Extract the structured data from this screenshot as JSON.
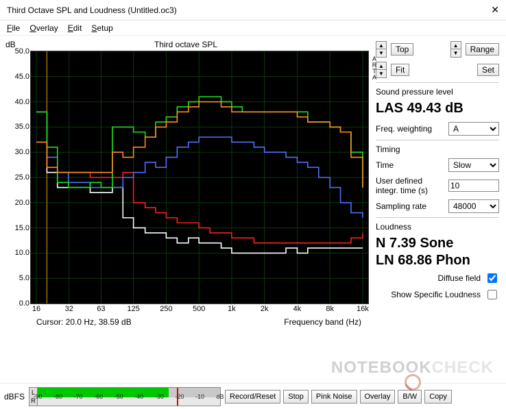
{
  "window": {
    "title": "Third Octave SPL and Loudness (Untitled.oc3)",
    "close": "✕"
  },
  "menu": {
    "file": "File",
    "overlay": "Overlay",
    "edit": "Edit",
    "setup": "Setup"
  },
  "chart": {
    "ylabel": "dB",
    "title": "Third octave SPL",
    "xlabel": "Frequency band (Hz)",
    "cursor": "Cursor:   20.0 Hz, 38.59 dB",
    "brand": "ARTA"
  },
  "controls": {
    "top": "Top",
    "fit": "Fit",
    "range": "Range",
    "set": "Set"
  },
  "spl": {
    "section": "Sound pressure level",
    "value": "LAS 49.43 dB",
    "weight_label": "Freq. weighting",
    "weight_value": "A"
  },
  "timing": {
    "section": "Timing",
    "time_label": "Time",
    "time_value": "Slow",
    "integ_label": "User defined\nintegr. time (s)",
    "integ_value": "10",
    "rate_label": "Sampling rate",
    "rate_value": "48000"
  },
  "loudness": {
    "section": "Loudness",
    "sone": "N 7.39 Sone",
    "phon": "LN 68.86 Phon",
    "diffuse": "Diffuse field",
    "specific": "Show Specific Loudness"
  },
  "bottom": {
    "dbfs": "dBFS",
    "L": "L",
    "R": "R",
    "ticks": [
      "-90",
      "-80",
      "-70",
      "-60",
      "-50",
      "-40",
      "-30",
      "-20",
      "-10",
      "dB"
    ],
    "record": "Record/Reset",
    "stop": "Stop",
    "pink": "Pink Noise",
    "overlay": "Overlay",
    "bw": "B/W",
    "copy": "Copy"
  },
  "watermark": {
    "a": "NOTEBO",
    "b": "OK",
    "c": "CHECK"
  },
  "chart_data": {
    "type": "line",
    "xlabel": "Frequency band (Hz)",
    "ylabel": "dB",
    "ylim": [
      0,
      50
    ],
    "xticks": [
      16,
      32,
      63,
      125,
      250,
      500,
      1000,
      2000,
      4000,
      8000,
      16000
    ],
    "xtick_labels": [
      "16",
      "32",
      "63",
      "125",
      "250",
      "500",
      "1k",
      "2k",
      "4k",
      "8k",
      "16k"
    ],
    "yticks": [
      0,
      5,
      10,
      15,
      20,
      25,
      30,
      35,
      40,
      45,
      50
    ],
    "freq_hz": [
      16,
      20,
      25,
      31.5,
      40,
      50,
      63,
      80,
      100,
      125,
      160,
      200,
      250,
      315,
      400,
      500,
      630,
      800,
      1000,
      1250,
      1600,
      2000,
      2500,
      3150,
      4000,
      5000,
      6300,
      8000,
      10000,
      12500,
      16000
    ],
    "series": [
      {
        "name": "white",
        "color": "#ffffff",
        "values": [
          38,
          26,
          23,
          23,
          23,
          22,
          22,
          23,
          17,
          15,
          14,
          14,
          13,
          12,
          13,
          12,
          12,
          11,
          10,
          10,
          10,
          10,
          10,
          11,
          10,
          11,
          11,
          11,
          11,
          11,
          11
        ]
      },
      {
        "name": "red",
        "color": "#ff2020",
        "values": [
          38,
          27,
          26,
          26,
          26,
          25,
          25,
          25,
          26,
          20,
          19,
          18,
          17,
          16,
          16,
          15,
          14,
          14,
          13,
          13,
          12,
          12,
          12,
          12,
          12,
          12,
          12,
          12,
          12,
          13,
          14
        ]
      },
      {
        "name": "blue",
        "color": "#5070ff",
        "values": [
          38,
          29,
          26,
          24,
          24,
          23,
          23,
          23,
          25,
          26,
          28,
          27,
          29,
          31,
          32,
          33,
          33,
          33,
          32,
          32,
          31,
          30,
          30,
          29,
          28,
          27,
          25,
          23,
          20,
          18,
          17
        ]
      },
      {
        "name": "green",
        "color": "#20e020",
        "values": [
          38,
          31,
          24,
          23,
          23,
          24,
          23,
          35,
          35,
          34,
          33,
          36,
          37,
          39,
          40,
          41,
          41,
          40,
          39,
          38,
          38,
          38,
          38,
          38,
          38,
          36,
          36,
          35,
          34,
          30,
          23
        ]
      },
      {
        "name": "orange",
        "color": "#ff9020",
        "values": [
          32,
          27,
          26,
          26,
          26,
          26,
          26,
          30,
          29,
          31,
          33,
          35,
          36,
          38,
          39,
          40,
          40,
          39,
          38,
          38,
          38,
          38,
          38,
          38,
          37,
          36,
          36,
          35,
          34,
          29,
          23
        ]
      }
    ]
  }
}
